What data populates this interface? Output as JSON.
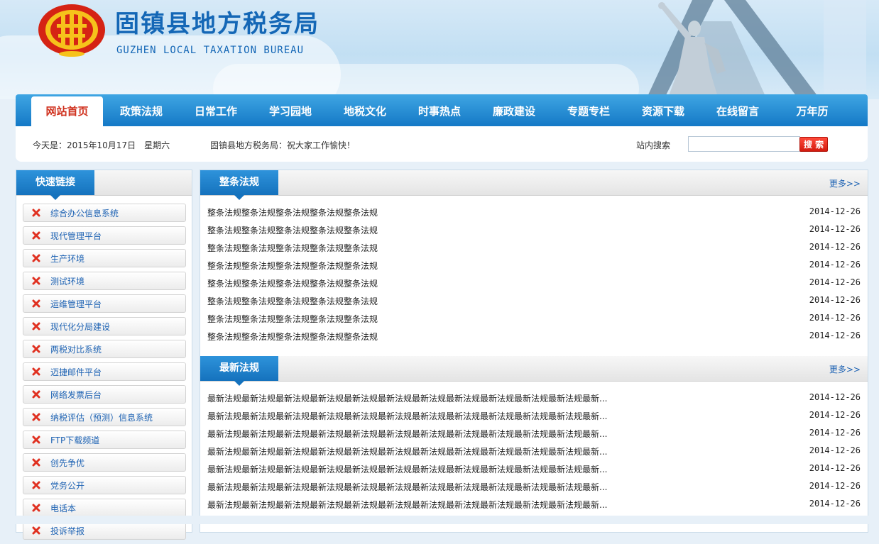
{
  "header": {
    "title": "固镇县地方税务局",
    "subtitle": "GUZHEN LOCAL TAXATION BUREAU",
    "logo_icon": "tax-emblem-icon"
  },
  "nav": {
    "items": [
      {
        "label": "网站首页",
        "active": true
      },
      {
        "label": "政策法规"
      },
      {
        "label": "日常工作"
      },
      {
        "label": "学习园地"
      },
      {
        "label": "地税文化"
      },
      {
        "label": "时事热点"
      },
      {
        "label": "廉政建设"
      },
      {
        "label": "专题专栏"
      },
      {
        "label": "资源下载"
      },
      {
        "label": "在线留言"
      },
      {
        "label": "万年历"
      }
    ]
  },
  "infobar": {
    "today": "今天是：2015年10月17日　星期六",
    "notice": "固镇县地方税务局：祝大家工作愉快！",
    "search_label": "站内搜索",
    "search_value": "",
    "search_button": "搜 索"
  },
  "quick_links": {
    "title": "快速链接",
    "items": [
      {
        "label": "综合办公信息系统"
      },
      {
        "label": "现代管理平台"
      },
      {
        "label": "生产环境"
      },
      {
        "label": "测试环境"
      },
      {
        "label": "运维管理平台"
      },
      {
        "label": "现代化分局建设"
      },
      {
        "label": "两税对比系统"
      },
      {
        "label": "迈捷邮件平台"
      },
      {
        "label": "网络发票后台"
      },
      {
        "label": "纳税评估（预测）信息系统"
      },
      {
        "label": "FTP下载频道"
      },
      {
        "label": "创先争优"
      },
      {
        "label": "党务公开"
      },
      {
        "label": "电话本"
      },
      {
        "label": "投诉举报"
      }
    ]
  },
  "sections": [
    {
      "title": "整条法规",
      "more": "更多>>",
      "rows": [
        {
          "title": "整条法规整条法规整条法规整条法规整条法规",
          "date": "2014-12-26"
        },
        {
          "title": "整条法规整条法规整条法规整条法规整条法规",
          "date": "2014-12-26"
        },
        {
          "title": "整条法规整条法规整条法规整条法规整条法规",
          "date": "2014-12-26"
        },
        {
          "title": "整条法规整条法规整条法规整条法规整条法规",
          "date": "2014-12-26"
        },
        {
          "title": "整条法规整条法规整条法规整条法规整条法规",
          "date": "2014-12-26"
        },
        {
          "title": "整条法规整条法规整条法规整条法规整条法规",
          "date": "2014-12-26"
        },
        {
          "title": "整条法规整条法规整条法规整条法规整条法规",
          "date": "2014-12-26"
        },
        {
          "title": "整条法规整条法规整条法规整条法规整条法规",
          "date": "2014-12-26"
        }
      ]
    },
    {
      "title": "最新法规",
      "more": "更多>>",
      "rows": [
        {
          "title": "最新法规最新法规最新法规最新法规最新法规最新法规最新法规最新法规最新法规最新法规最新法规最新...",
          "date": "2014-12-26"
        },
        {
          "title": "最新法规最新法规最新法规最新法规最新法规最新法规最新法规最新法规最新法规最新法规最新法规最新...",
          "date": "2014-12-26"
        },
        {
          "title": "最新法规最新法规最新法规最新法规最新法规最新法规最新法规最新法规最新法规最新法规最新法规最新...",
          "date": "2014-12-26"
        },
        {
          "title": "最新法规最新法规最新法规最新法规最新法规最新法规最新法规最新法规最新法规最新法规最新法规最新...",
          "date": "2014-12-26"
        },
        {
          "title": "最新法规最新法规最新法规最新法规最新法规最新法规最新法规最新法规最新法规最新法规最新法规最新...",
          "date": "2014-12-26"
        },
        {
          "title": "最新法规最新法规最新法规最新法规最新法规最新法规最新法规最新法规最新法规最新法规最新法规最新...",
          "date": "2014-12-26"
        },
        {
          "title": "最新法规最新法规最新法规最新法规最新法规最新法规最新法规最新法规最新法规最新法规最新法规最新...",
          "date": "2014-12-26"
        }
      ]
    }
  ],
  "colors": {
    "brand_blue": "#1467b6",
    "nav_blue": "#1479c6",
    "active_red": "#d0321f",
    "icon_red": "#e03020"
  }
}
